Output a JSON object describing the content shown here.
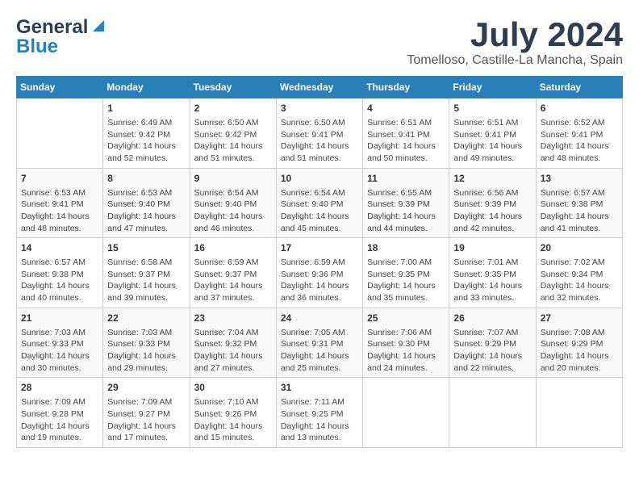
{
  "logo": {
    "line1": "General",
    "line2": "Blue"
  },
  "title": "July 2024",
  "location": "Tomelloso, Castille-La Mancha, Spain",
  "days_header": [
    "Sunday",
    "Monday",
    "Tuesday",
    "Wednesday",
    "Thursday",
    "Friday",
    "Saturday"
  ],
  "weeks": [
    [
      {
        "day": "",
        "content": ""
      },
      {
        "day": "1",
        "content": "Sunrise: 6:49 AM\nSunset: 9:42 PM\nDaylight: 14 hours\nand 52 minutes."
      },
      {
        "day": "2",
        "content": "Sunrise: 6:50 AM\nSunset: 9:42 PM\nDaylight: 14 hours\nand 51 minutes."
      },
      {
        "day": "3",
        "content": "Sunrise: 6:50 AM\nSunset: 9:41 PM\nDaylight: 14 hours\nand 51 minutes."
      },
      {
        "day": "4",
        "content": "Sunrise: 6:51 AM\nSunset: 9:41 PM\nDaylight: 14 hours\nand 50 minutes."
      },
      {
        "day": "5",
        "content": "Sunrise: 6:51 AM\nSunset: 9:41 PM\nDaylight: 14 hours\nand 49 minutes."
      },
      {
        "day": "6",
        "content": "Sunrise: 6:52 AM\nSunset: 9:41 PM\nDaylight: 14 hours\nand 48 minutes."
      }
    ],
    [
      {
        "day": "7",
        "content": "Sunrise: 6:53 AM\nSunset: 9:41 PM\nDaylight: 14 hours\nand 48 minutes."
      },
      {
        "day": "8",
        "content": "Sunrise: 6:53 AM\nSunset: 9:40 PM\nDaylight: 14 hours\nand 47 minutes."
      },
      {
        "day": "9",
        "content": "Sunrise: 6:54 AM\nSunset: 9:40 PM\nDaylight: 14 hours\nand 46 minutes."
      },
      {
        "day": "10",
        "content": "Sunrise: 6:54 AM\nSunset: 9:40 PM\nDaylight: 14 hours\nand 45 minutes."
      },
      {
        "day": "11",
        "content": "Sunrise: 6:55 AM\nSunset: 9:39 PM\nDaylight: 14 hours\nand 44 minutes."
      },
      {
        "day": "12",
        "content": "Sunrise: 6:56 AM\nSunset: 9:39 PM\nDaylight: 14 hours\nand 42 minutes."
      },
      {
        "day": "13",
        "content": "Sunrise: 6:57 AM\nSunset: 9:38 PM\nDaylight: 14 hours\nand 41 minutes."
      }
    ],
    [
      {
        "day": "14",
        "content": "Sunrise: 6:57 AM\nSunset: 9:38 PM\nDaylight: 14 hours\nand 40 minutes."
      },
      {
        "day": "15",
        "content": "Sunrise: 6:58 AM\nSunset: 9:37 PM\nDaylight: 14 hours\nand 39 minutes."
      },
      {
        "day": "16",
        "content": "Sunrise: 6:59 AM\nSunset: 9:37 PM\nDaylight: 14 hours\nand 37 minutes."
      },
      {
        "day": "17",
        "content": "Sunrise: 6:59 AM\nSunset: 9:36 PM\nDaylight: 14 hours\nand 36 minutes."
      },
      {
        "day": "18",
        "content": "Sunrise: 7:00 AM\nSunset: 9:35 PM\nDaylight: 14 hours\nand 35 minutes."
      },
      {
        "day": "19",
        "content": "Sunrise: 7:01 AM\nSunset: 9:35 PM\nDaylight: 14 hours\nand 33 minutes."
      },
      {
        "day": "20",
        "content": "Sunrise: 7:02 AM\nSunset: 9:34 PM\nDaylight: 14 hours\nand 32 minutes."
      }
    ],
    [
      {
        "day": "21",
        "content": "Sunrise: 7:03 AM\nSunset: 9:33 PM\nDaylight: 14 hours\nand 30 minutes."
      },
      {
        "day": "22",
        "content": "Sunrise: 7:03 AM\nSunset: 9:33 PM\nDaylight: 14 hours\nand 29 minutes."
      },
      {
        "day": "23",
        "content": "Sunrise: 7:04 AM\nSunset: 9:32 PM\nDaylight: 14 hours\nand 27 minutes."
      },
      {
        "day": "24",
        "content": "Sunrise: 7:05 AM\nSunset: 9:31 PM\nDaylight: 14 hours\nand 25 minutes."
      },
      {
        "day": "25",
        "content": "Sunrise: 7:06 AM\nSunset: 9:30 PM\nDaylight: 14 hours\nand 24 minutes."
      },
      {
        "day": "26",
        "content": "Sunrise: 7:07 AM\nSunset: 9:29 PM\nDaylight: 14 hours\nand 22 minutes."
      },
      {
        "day": "27",
        "content": "Sunrise: 7:08 AM\nSunset: 9:29 PM\nDaylight: 14 hours\nand 20 minutes."
      }
    ],
    [
      {
        "day": "28",
        "content": "Sunrise: 7:09 AM\nSunset: 9:28 PM\nDaylight: 14 hours\nand 19 minutes."
      },
      {
        "day": "29",
        "content": "Sunrise: 7:09 AM\nSunset: 9:27 PM\nDaylight: 14 hours\nand 17 minutes."
      },
      {
        "day": "30",
        "content": "Sunrise: 7:10 AM\nSunset: 9:26 PM\nDaylight: 14 hours\nand 15 minutes."
      },
      {
        "day": "31",
        "content": "Sunrise: 7:11 AM\nSunset: 9:25 PM\nDaylight: 14 hours\nand 13 minutes."
      },
      {
        "day": "",
        "content": ""
      },
      {
        "day": "",
        "content": ""
      },
      {
        "day": "",
        "content": ""
      }
    ]
  ]
}
